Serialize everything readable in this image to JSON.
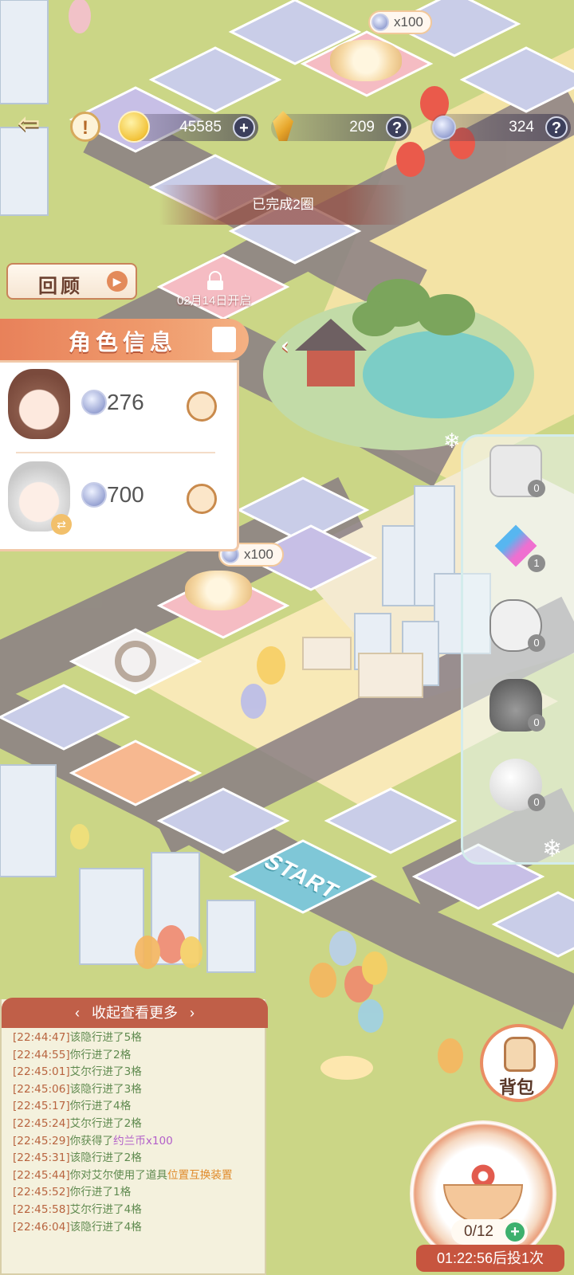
{
  "top_bar": {
    "back_icon": "back-arrow-icon",
    "alert_icon": "exclamation-icon",
    "gold_value": "45585",
    "gold_action": "+",
    "gem_value": "209",
    "gem_help": "?",
    "ticket_value": "324",
    "ticket_help": "?"
  },
  "banner_text": "已完成2圈",
  "review_label": "回顾",
  "locked_tile": {
    "text": "02月14日开启"
  },
  "board": {
    "start_label": "START",
    "reward_badges": [
      "x100",
      "x100"
    ]
  },
  "character_panel": {
    "title": "角色信息",
    "characters": [
      {
        "value": "276"
      },
      {
        "value": "700"
      }
    ]
  },
  "props": [
    {
      "name": "dice",
      "count": "0"
    },
    {
      "name": "swap-arrows",
      "count": "1"
    },
    {
      "name": "grab-hand",
      "count": "0"
    },
    {
      "name": "sack",
      "count": "0"
    },
    {
      "name": "snowball",
      "count": "0"
    }
  ],
  "log": {
    "header": "收起查看更多",
    "entries": [
      {
        "time": "[22:44:47]",
        "text": "该隐行进了5格"
      },
      {
        "time": "[22:44:55]",
        "text": "你行进了2格"
      },
      {
        "time": "[22:45:01]",
        "text": "艾尔行进了3格"
      },
      {
        "time": "[22:45:06]",
        "text": "该隐行进了3格"
      },
      {
        "time": "[22:45:17]",
        "text": "你行进了4格"
      },
      {
        "time": "[22:45:24]",
        "text": "艾尔行进了2格"
      },
      {
        "time": "[22:45:29]",
        "text": "你获得了",
        "highlight": "约兰币x100"
      },
      {
        "time": "[22:45:31]",
        "text": "该隐行进了2格"
      },
      {
        "time": "[22:45:44]",
        "text": "你对艾尔使用了道具",
        "highlight2": "位置互换装置"
      },
      {
        "time": "[22:45:52]",
        "text": "你行进了1格"
      },
      {
        "time": "[22:45:58]",
        "text": "艾尔行进了4格"
      },
      {
        "time": "[22:46:04]",
        "text": "该隐行进了4格"
      }
    ]
  },
  "bag_label": "背包",
  "dice": {
    "count": "0/12",
    "timer": "01:22:56后投1次"
  },
  "colors": {
    "accent": "#e8815a",
    "log_time": "#b8643f",
    "log_text": "#5f8a4f",
    "log_item": "#b25ec9",
    "grass": "#cfd98a"
  }
}
